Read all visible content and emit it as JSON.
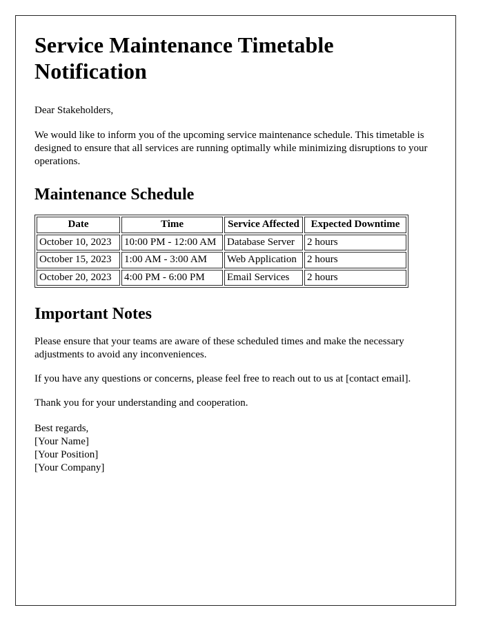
{
  "document": {
    "title": "Service Maintenance Timetable Notification",
    "salutation": "Dear Stakeholders,",
    "intro_paragraph": "We would like to inform you of the upcoming service maintenance schedule. This timetable is designed to ensure that all services are running optimally while minimizing disruptions to your operations.",
    "schedule_heading": "Maintenance Schedule",
    "notes_heading": "Important Notes",
    "notes": [
      "Please ensure that your teams are aware of these scheduled times and make the necessary adjustments to avoid any inconveniences.",
      "If you have any questions or concerns, please feel free to reach out to us at [contact email].",
      "Thank you for your understanding and cooperation."
    ],
    "signature": {
      "closing": "Best regards,",
      "name": "[Your Name]",
      "position": "[Your Position]",
      "company": "[Your Company]"
    }
  },
  "schedule_table": {
    "columns": [
      "Date",
      "Time",
      "Service Affected",
      "Expected Downtime"
    ],
    "rows": [
      {
        "date": "October 10, 2023",
        "time": "10:00 PM - 12:00 AM",
        "service": "Database Server",
        "downtime": "2 hours"
      },
      {
        "date": "October 15, 2023",
        "time": "1:00 AM - 3:00 AM",
        "service": "Web Application",
        "downtime": "2 hours"
      },
      {
        "date": "October 20, 2023",
        "time": "4:00 PM - 6:00 PM",
        "service": "Email Services",
        "downtime": "2 hours"
      }
    ]
  },
  "colors": {
    "page_background": "#ffffff",
    "text": "#000000",
    "border": "#2a2a2a"
  }
}
